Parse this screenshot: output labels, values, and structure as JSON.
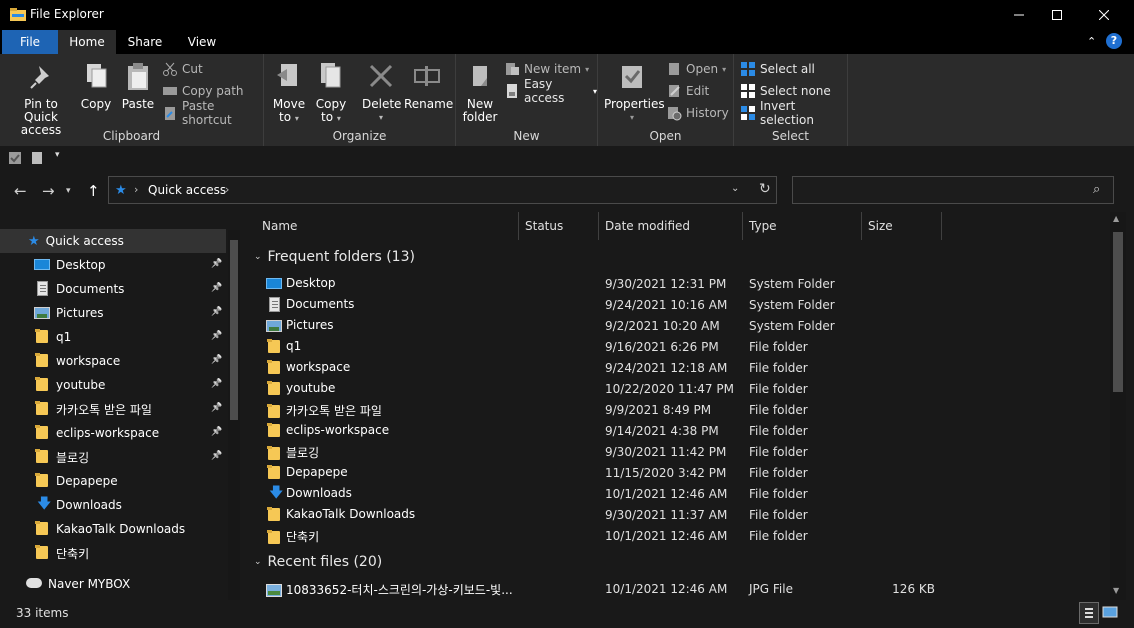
{
  "window": {
    "title": "File Explorer",
    "minimize": "—",
    "maximize": "☐",
    "close": "✕"
  },
  "ribbon_tabs": [
    "File",
    "Home",
    "Share",
    "View"
  ],
  "ribbon": {
    "clipboard": {
      "label": "Clipboard",
      "pin_to_quick_access": [
        "Pin to Quick",
        "access"
      ],
      "copy": "Copy",
      "paste": "Paste",
      "cut": "Cut",
      "copy_path": "Copy path",
      "paste_shortcut": "Paste shortcut"
    },
    "organize": {
      "label": "Organize",
      "move_to": [
        "Move",
        "to"
      ],
      "copy_to": [
        "Copy",
        "to"
      ],
      "delete": "Delete",
      "rename": "Rename"
    },
    "new": {
      "label": "New",
      "new_folder": [
        "New",
        "folder"
      ],
      "new_item": "New item",
      "easy_access": "Easy access"
    },
    "open": {
      "label": "Open",
      "properties": "Properties",
      "open": "Open",
      "edit": "Edit",
      "history": "History"
    },
    "select": {
      "label": "Select",
      "select_all": "Select all",
      "select_none": "Select none",
      "invert_selection": "Invert selection"
    }
  },
  "address": {
    "crumb": "Quick access",
    "search_placeholder": ""
  },
  "nav_pane": {
    "quick_access": "Quick access",
    "items": [
      {
        "label": "Desktop",
        "icon": "desktop-icon",
        "pinned": true
      },
      {
        "label": "Documents",
        "icon": "documents-icon",
        "pinned": true
      },
      {
        "label": "Pictures",
        "icon": "pictures-icon",
        "pinned": true
      },
      {
        "label": "q1",
        "icon": "folder-icon",
        "pinned": true
      },
      {
        "label": "workspace",
        "icon": "folder-icon",
        "pinned": true
      },
      {
        "label": "youtube",
        "icon": "folder-icon",
        "pinned": true
      },
      {
        "label": "카카오톡 받은 파일",
        "icon": "folder-icon",
        "pinned": true
      },
      {
        "label": "eclips-workspace",
        "icon": "folder-icon",
        "pinned": true
      },
      {
        "label": "블로깅",
        "icon": "folder-icon",
        "pinned": true
      },
      {
        "label": "Depapepe",
        "icon": "folder-icon",
        "pinned": false
      },
      {
        "label": "Downloads",
        "icon": "downloads-icon",
        "pinned": false
      },
      {
        "label": "KakaoTalk Downloads",
        "icon": "folder-icon",
        "pinned": false
      },
      {
        "label": "단축키",
        "icon": "folder-icon",
        "pinned": false
      }
    ],
    "naver_mybox": "Naver MYBOX"
  },
  "columns": {
    "name": "Name",
    "status": "Status",
    "date_modified": "Date modified",
    "type": "Type",
    "size": "Size"
  },
  "groups": {
    "frequent": "Frequent folders (13)",
    "recent": "Recent files (20)"
  },
  "frequent_folders": [
    {
      "name": "Desktop",
      "icon": "desktop-icon",
      "date": "9/30/2021 12:31 PM",
      "type": "System Folder"
    },
    {
      "name": "Documents",
      "icon": "documents-icon",
      "date": "9/24/2021 10:16 AM",
      "type": "System Folder"
    },
    {
      "name": "Pictures",
      "icon": "pictures-icon",
      "date": "9/2/2021 10:20 AM",
      "type": "System Folder"
    },
    {
      "name": "q1",
      "icon": "folder-icon",
      "date": "9/16/2021 6:26 PM",
      "type": "File folder"
    },
    {
      "name": "workspace",
      "icon": "folder-icon",
      "date": "9/24/2021 12:18 AM",
      "type": "File folder"
    },
    {
      "name": "youtube",
      "icon": "folder-icon",
      "date": "10/22/2020 11:47 PM",
      "type": "File folder"
    },
    {
      "name": "카카오톡 받은 파일",
      "icon": "folder-icon",
      "date": "9/9/2021 8:49 PM",
      "type": "File folder"
    },
    {
      "name": "eclips-workspace",
      "icon": "folder-icon",
      "date": "9/14/2021 4:38 PM",
      "type": "File folder"
    },
    {
      "name": "블로깅",
      "icon": "folder-icon",
      "date": "9/30/2021 11:42 PM",
      "type": "File folder"
    },
    {
      "name": "Depapepe",
      "icon": "folder-icon",
      "date": "11/15/2020 3:42 PM",
      "type": "File folder"
    },
    {
      "name": "Downloads",
      "icon": "downloads-icon",
      "date": "10/1/2021 12:46 AM",
      "type": "File folder"
    },
    {
      "name": "KakaoTalk Downloads",
      "icon": "folder-icon",
      "date": "9/30/2021 11:37 AM",
      "type": "File folder"
    },
    {
      "name": "단축키",
      "icon": "folder-icon",
      "date": "10/1/2021 12:46 AM",
      "type": "File folder"
    }
  ],
  "recent_files": [
    {
      "name": "10833652-터치-스크린의-가상-키보드-빛...",
      "icon": "jpg-icon",
      "date": "10/1/2021 12:46 AM",
      "type": "JPG File",
      "size": "126 KB"
    }
  ],
  "status": {
    "item_count": "33 items"
  },
  "colors": {
    "file_tab": "#1e64b4",
    "background": "#191919",
    "ribbon": "#2b2b2b",
    "accent": "#2b8be6",
    "folder": "#f6c855"
  }
}
